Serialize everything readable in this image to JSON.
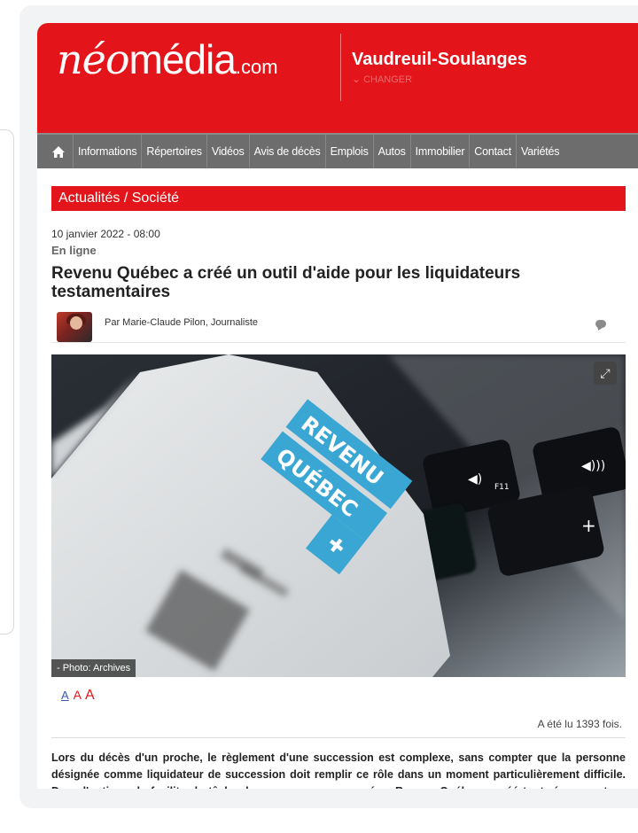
{
  "site": {
    "logo_neo": "néo",
    "logo_media": "média",
    "logo_dotcom": ".com",
    "region": "Vaudreuil-Soulanges",
    "change_label": "CHANGER"
  },
  "nav": {
    "items": [
      "Informations",
      "Répertoires",
      "Vidéos",
      "Avis de décès",
      "Emplois",
      "Autos",
      "Immobilier",
      "Contact",
      "Variétés"
    ]
  },
  "article": {
    "section": "Actualités / Société",
    "date": "10 janvier 2022 - 08:00",
    "status": "En ligne",
    "headline": "Revenu Québec a créé un outil d'aide pour les liquidateurs testamentaires",
    "byline": "Par Marie-Claude Pilon, Journaliste",
    "photo_caption": "- Photo: Archives",
    "photo_logo_lines": [
      "REVENU",
      "QUÉBEC"
    ],
    "key_label": "F11",
    "font_sizes": [
      "A",
      "A",
      "A"
    ],
    "views": "A été lu 1393 fois.",
    "lede": "Lors du décès d'un proche, le règlement d'une succession est complexe, sans compter que la personne désignée comme liquidateur de succession doit remplir ce rôle dans un moment particulièrement difficile. Dans l'optique de faciliter la tâche des personnes concernées, Revenu Québec a créé tout récemment un outil d'aide pour les liquidateurs testamentaires."
  },
  "colors": {
    "brand_red": "#e3151a",
    "nav_gray": "#6d6d6d",
    "revenu_blue": "#3aa6d3"
  }
}
